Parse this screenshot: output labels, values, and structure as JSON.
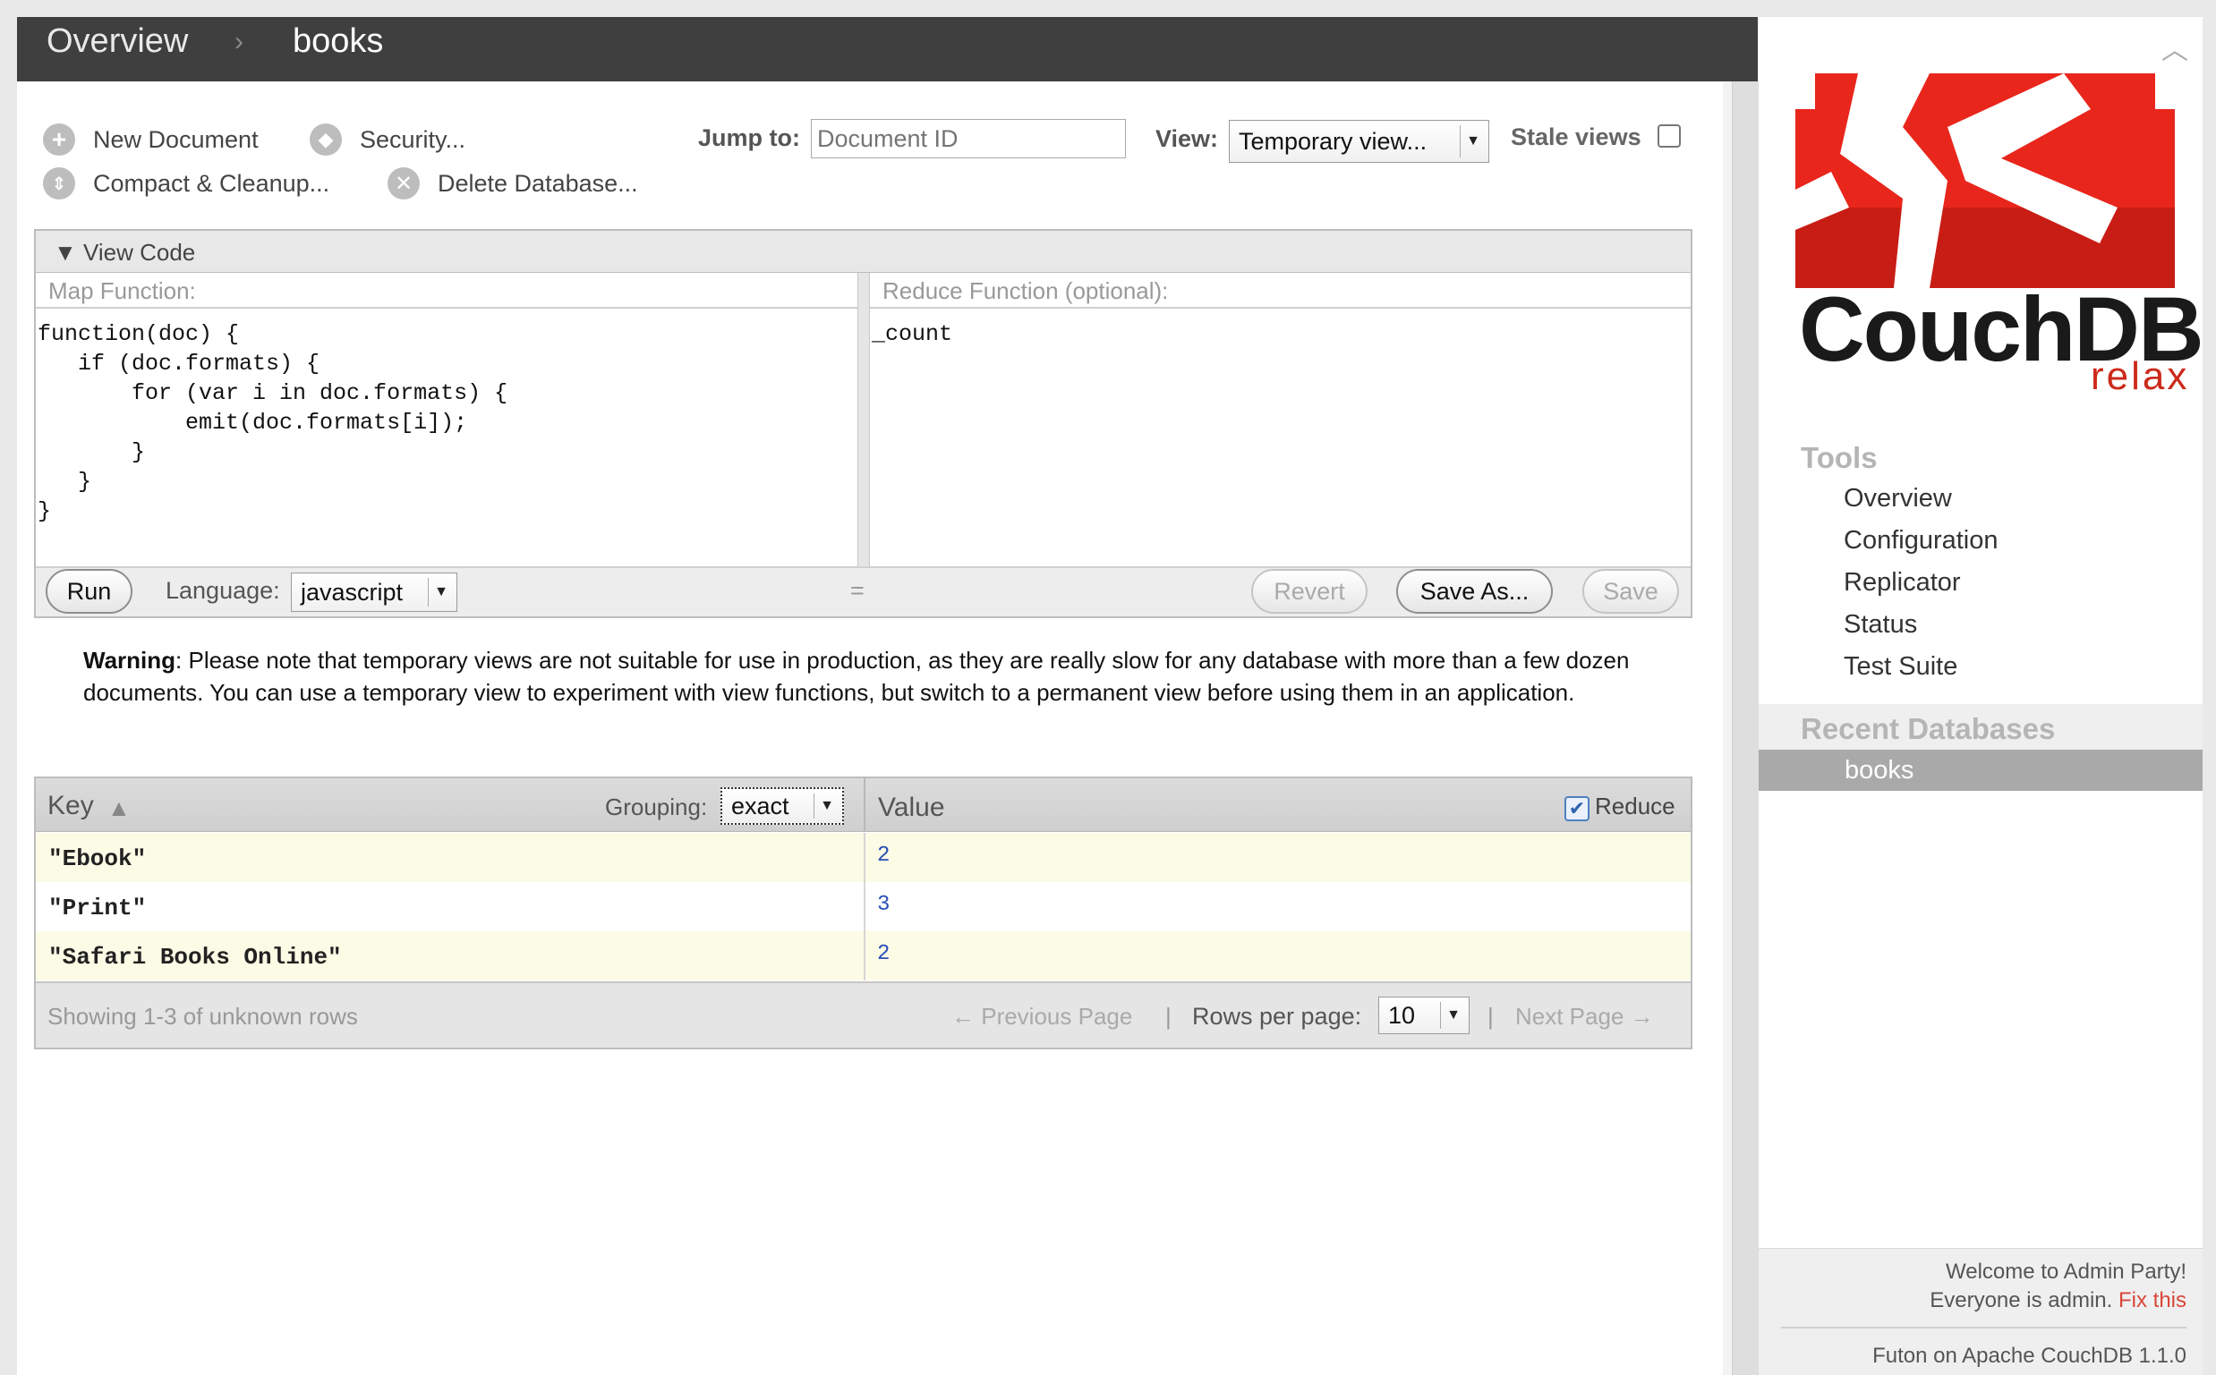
{
  "breadcrumb": {
    "root": "Overview",
    "separator": "›",
    "current": "books"
  },
  "toolbar": {
    "new_document": "New Document",
    "security": "Security...",
    "compact": "Compact & Cleanup...",
    "delete_db": "Delete Database...",
    "jump_label": "Jump to:",
    "jump_placeholder": "Document ID",
    "view_label": "View:",
    "view_selected": "Temporary view...",
    "stale_label": "Stale views",
    "stale_checked": false
  },
  "view_code": {
    "title": "View Code",
    "map_header": "Map Function:",
    "reduce_header": "Reduce Function (optional):",
    "map_code": "function(doc) {\n   if (doc.formats) {\n       for (var i in doc.formats) {\n           emit(doc.formats[i]);\n       }\n   }\n}",
    "reduce_code": "_count",
    "run": "Run",
    "language_label": "Language:",
    "language": "javascript",
    "handle": "=",
    "revert": "Revert",
    "save_as": "Save As...",
    "save": "Save"
  },
  "warning": {
    "label": "Warning",
    "text": ": Please note that temporary views are not suitable for use in production, as they are really slow for any database with more than a few dozen documents. You can use a temporary view to experiment with view functions, but switch to a permanent view before using them in an application."
  },
  "results": {
    "key_header": "Key",
    "grouping_label": "Grouping:",
    "grouping": "exact",
    "value_header": "Value",
    "reduce_label": "Reduce",
    "reduce_checked": true,
    "rows": [
      {
        "key": "\"Ebook\"",
        "value": "2"
      },
      {
        "key": "\"Print\"",
        "value": "3"
      },
      {
        "key": "\"Safari Books Online\"",
        "value": "2"
      }
    ],
    "showing": "Showing 1-3 of unknown rows",
    "prev": "← Previous Page",
    "rows_per_page_label": "Rows per page:",
    "rows_per_page": "10",
    "next": "Next Page →",
    "pipe": "|"
  },
  "sidebar": {
    "logo_word": "CouchDB",
    "logo_tag": "relax",
    "tools_title": "Tools",
    "tools": [
      "Overview",
      "Configuration",
      "Replicator",
      "Status",
      "Test Suite"
    ],
    "recent_title": "Recent Databases",
    "recent": [
      "books"
    ],
    "welcome_line1": "Welcome to Admin Party!",
    "welcome_line2": "Everyone is admin.",
    "fix_this": "Fix this",
    "version": "Futon on Apache CouchDB 1.1.0"
  },
  "colors": {
    "header": "#3f3f3f",
    "logo_red": "#e8261c",
    "link_red": "#d9463a",
    "value_blue": "#2a4fb8",
    "row_tint": "#fbfbe6"
  },
  "icons": [
    "plus-circle-icon",
    "shield-icon",
    "compress-icon",
    "close-circle-icon",
    "triangle-down-icon",
    "sort-up-icon",
    "check-icon",
    "chevron-up-icon",
    "couchdb-logo"
  ]
}
